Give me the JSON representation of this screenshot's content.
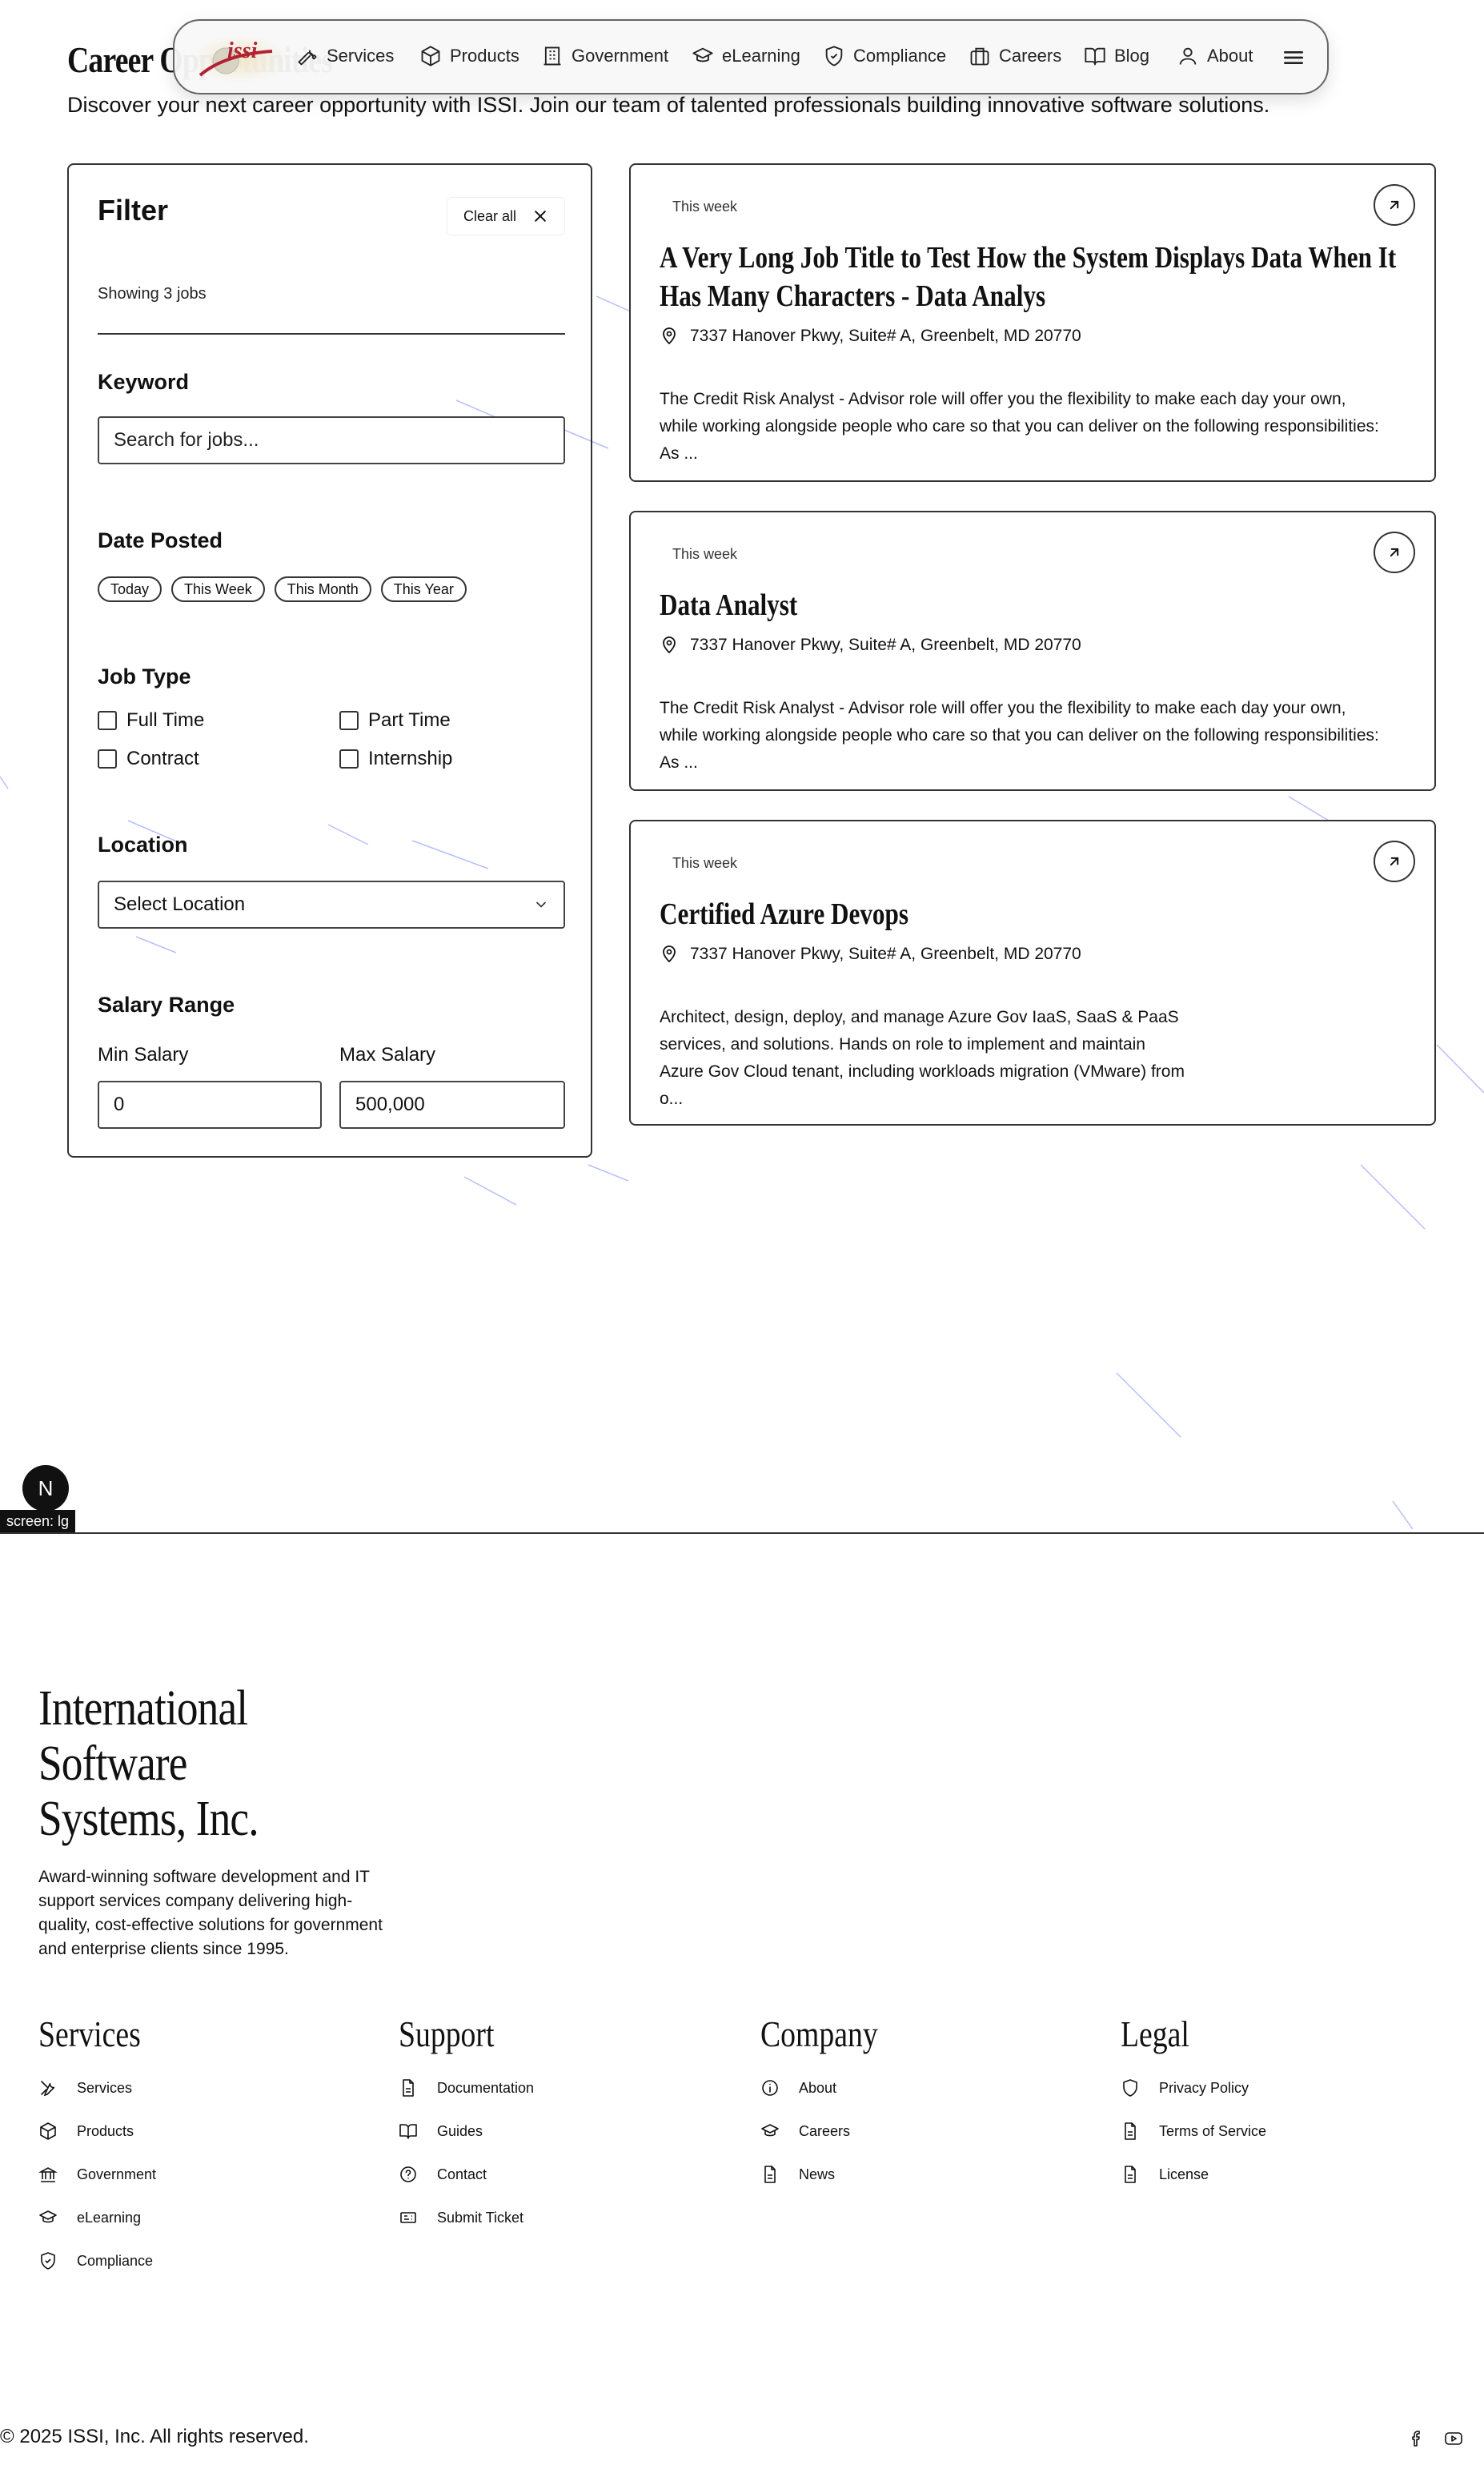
{
  "page": {
    "title": "Career Opportunities",
    "intro": "Discover your next career opportunity with ISSI. Join our team of talented professionals building innovative software solutions."
  },
  "nav": {
    "logo_text": "issi",
    "items": [
      {
        "label": "Services",
        "icon": "wrench-icon"
      },
      {
        "label": "Products",
        "icon": "box-icon"
      },
      {
        "label": "Government",
        "icon": "building-icon"
      },
      {
        "label": "eLearning",
        "icon": "graduation-cap-icon"
      },
      {
        "label": "Compliance",
        "icon": "shield-check-icon"
      },
      {
        "label": "Careers",
        "icon": "briefcase-icon"
      },
      {
        "label": "Blog",
        "icon": "book-open-icon"
      },
      {
        "label": "About",
        "icon": "user-icon"
      }
    ],
    "menu_icon": "hamburger-menu-icon"
  },
  "filter": {
    "title": "Filter",
    "clear_all": "Clear all",
    "showing": "Showing 3 jobs",
    "keyword_label": "Keyword",
    "keyword_placeholder": "Search for jobs...",
    "date_label": "Date Posted",
    "date_options": [
      "Today",
      "This Week",
      "This Month",
      "This Year"
    ],
    "jobtype_label": "Job Type",
    "jobtypes": [
      "Full Time",
      "Part Time",
      "Contract",
      "Internship"
    ],
    "location_label": "Location",
    "location_placeholder": "Select Location",
    "salary_label": "Salary Range",
    "min_label": "Min Salary",
    "max_label": "Max Salary",
    "min_value": "0",
    "max_value": "500,000"
  },
  "jobs": [
    {
      "date": "This week",
      "title": "A Very Long Job Title to Test How the System Displays Data When It Has Many Characters - Data Analys",
      "location": "7337 Hanover Pkwy, Suite# A, Greenbelt, MD 20770",
      "desc": "The Credit Risk Analyst - Advisor role will offer you the flexibility to make each day your own, while working alongside people who care so that you can deliver on the following responsibilities: As ..."
    },
    {
      "date": "This week",
      "title": "Data Analyst",
      "location": "7337 Hanover Pkwy, Suite# A, Greenbelt, MD 20770",
      "desc": "The Credit Risk Analyst - Advisor role will offer you the flexibility to make each day your own, while working alongside people who care so that you can deliver on the following responsibilities: As ..."
    },
    {
      "date": "This week",
      "title": "Certified Azure Devops",
      "location": "7337 Hanover Pkwy, Suite# A, Greenbelt, MD 20770",
      "desc": "Architect, design, deploy, and manage Azure Gov IaaS, SaaS & PaaS services, and solutions. Hands on role to implement and maintain Azure Gov Cloud tenant, including workloads migration (VMware) from o..."
    }
  ],
  "dev": {
    "badge": "N",
    "screen_tag": "screen: lg"
  },
  "footer": {
    "brand_lines": [
      "International",
      "Software",
      "Systems, Inc."
    ],
    "description": "Award-winning software development and IT support services company delivering high-quality, cost-effective solutions for government and enterprise clients since 1995.",
    "columns": [
      {
        "title": "Services",
        "links": [
          {
            "label": "Services",
            "icon": "tools-icon"
          },
          {
            "label": "Products",
            "icon": "box-icon"
          },
          {
            "label": "Government",
            "icon": "bank-icon"
          },
          {
            "label": "eLearning",
            "icon": "graduation-cap-icon"
          },
          {
            "label": "Compliance",
            "icon": "shield-check-icon"
          }
        ]
      },
      {
        "title": "Support",
        "links": [
          {
            "label": "Documentation",
            "icon": "file-text-icon"
          },
          {
            "label": "Guides",
            "icon": "book-open-icon"
          },
          {
            "label": "Contact",
            "icon": "help-circle-icon"
          },
          {
            "label": "Submit Ticket",
            "icon": "ticket-icon"
          }
        ]
      },
      {
        "title": "Company",
        "links": [
          {
            "label": "About",
            "icon": "info-icon"
          },
          {
            "label": "Careers",
            "icon": "graduation-cap-icon"
          },
          {
            "label": "News",
            "icon": "file-text-icon"
          }
        ]
      },
      {
        "title": "Legal",
        "links": [
          {
            "label": "Privacy Policy",
            "icon": "shield-icon"
          },
          {
            "label": "Terms of Service",
            "icon": "file-text-icon"
          },
          {
            "label": "License",
            "icon": "file-text-icon"
          }
        ]
      }
    ],
    "copyright": "© 2025 ISSI, Inc. All rights reserved.",
    "social": [
      {
        "icon": "facebook-icon"
      },
      {
        "icon": "youtube-icon"
      }
    ]
  },
  "colors": {
    "accent_line": "#7b8cf0",
    "logo_red": "#b22234",
    "text": "#111111"
  }
}
